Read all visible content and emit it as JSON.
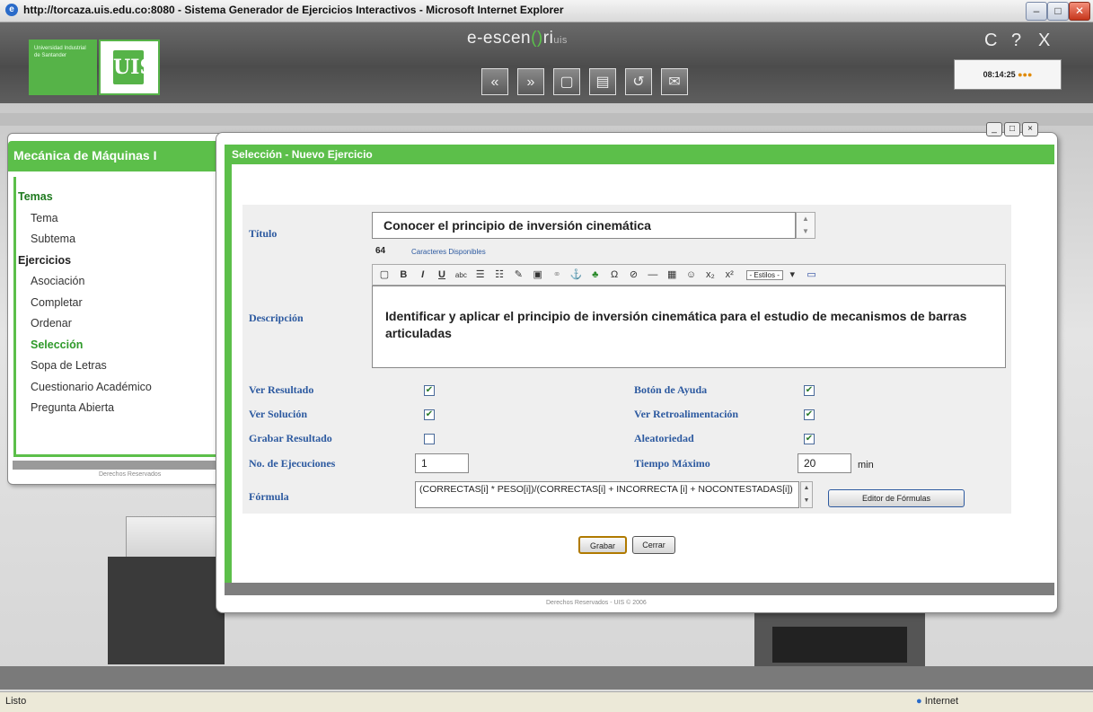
{
  "browser": {
    "title": "http://torcaza.uis.edu.co:8080 - Sistema Generador de Ejercicios Interactivos - Microsoft Internet Explorer",
    "status": "Listo",
    "zone": "Internet"
  },
  "app": {
    "logo_text": "Universidad Industrial de Santander",
    "logo_mark": "UIS",
    "brand_prefix": "e-escen",
    "brand_mid": "()",
    "brand_suffix": "ri",
    "brand_sub": "uis",
    "header_controls": [
      "C",
      "?",
      "X"
    ],
    "nav_buttons": [
      "«",
      "»",
      "▢",
      "▤",
      "↺",
      "✉"
    ],
    "clock": "08:14:25"
  },
  "left_panel": {
    "title": "Mecánica de Máquinas I",
    "sections": [
      {
        "heading": "Temas",
        "items": [
          "Tema",
          "Subtema"
        ]
      },
      {
        "heading": "Ejercicios",
        "items": [
          "Asociación",
          "Completar",
          "Ordenar",
          "Selección",
          "Sopa de Letras",
          "Cuestionario Académico",
          "Pregunta Abierta"
        ]
      }
    ],
    "selected": "Selección",
    "footer": "Derechos Reservados"
  },
  "dialog": {
    "title": "Selección - Nuevo Ejercicio",
    "footer": "Derechos Reservados - UIS © 2006",
    "titulo_label": "Título",
    "titulo_value": "Conocer el principio de inversión cinemática",
    "chars_count": "64",
    "chars_label": "Caracteres Disponibles",
    "descripcion_label": "Descripción",
    "descripcion_value": "Identificar y aplicar el principio de inversión cinemática para el estudio de mecanismos de barras articuladas",
    "toolbar_style": "- Estilos -",
    "options": {
      "ver_resultado": {
        "label": "Ver Resultado",
        "checked": true
      },
      "ver_solucion": {
        "label": "Ver Solución",
        "checked": true
      },
      "grabar_resultado": {
        "label": "Grabar Resultado",
        "checked": false
      },
      "boton_ayuda": {
        "label": "Botón de Ayuda",
        "checked": true
      },
      "ver_retro": {
        "label": "Ver Retroalimentación",
        "checked": true
      },
      "aleatoriedad": {
        "label": "Aleatoriedad",
        "checked": true
      }
    },
    "ejecuciones_label": "No. de Ejecuciones",
    "ejecuciones_value": "1",
    "tiempo_label": "Tiempo Máximo",
    "tiempo_value": "20",
    "tiempo_unit": "min",
    "formula_label": "Fórmula",
    "formula_value": "(CORRECTAS[i] * PESO[i])/(CORRECTAS[i] + INCORRECTA [i] + NOCONTESTADAS[i])",
    "editor_button": "Editor de Fórmulas",
    "save_button": "Grabar",
    "close_button": "Cerrar"
  }
}
